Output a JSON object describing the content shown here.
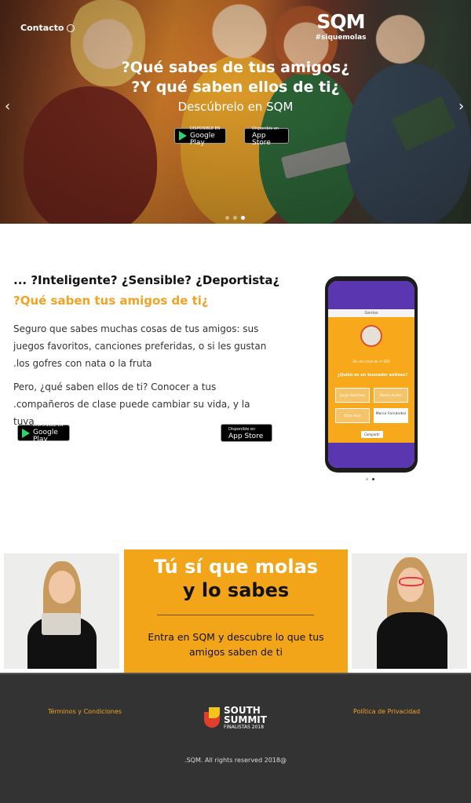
{
  "hero": {
    "contact_label": "Contacto",
    "logo_text": "SQM",
    "logo_tag": "#siquemolas",
    "title_line1": "?Qué sabes de tus amigos¿",
    "title_line2": "?Y qué saben ellos de ti¿",
    "subtitle": "Descúbrelo en SQM",
    "carousel_slides": 3,
    "active_slide": 3
  },
  "stores": {
    "google_small": "DISPONIBLE EN",
    "google_name": "Google Play",
    "apple_small": "Disponible en",
    "apple_name": "App Store"
  },
  "intro": {
    "question": "... ?Inteligente? ¿Sensible? ¿Deportista¿",
    "orange_question": "?Qué saben tus amigos de ti¿",
    "paragraph1": "Seguro que sabes muchas cosas de tus amigos: sus juegos favoritos, canciones preferidas, o si les gustan .los gofres con nata o la fruta",
    "paragraph2": "Pero, ¿qué saben ellos de ti? Conocer a tus .compañeros de clase puede cambiar su vida, y la tuya"
  },
  "phone_screen": {
    "header": "Genios",
    "small_text": "De una clase de 1º ESO",
    "question": "¿Quién es un buscador exitoso?",
    "options": [
      "Jorge Sanchez",
      "Marta Andes",
      "Elisa Ruiz",
      "Marco Fernández"
    ],
    "selected_option": "Marco Fernández",
    "share_label": "Compartir"
  },
  "banner": {
    "title1": "Tú sí que molas",
    "title2": "y lo sabes",
    "text": "Entra en SQM y descubre lo que tus amigos saben de ti"
  },
  "footer": {
    "terms": "Términos y Condiciones",
    "privacy": "Política de Privacidad",
    "sponsor_line1": "SOUTH",
    "sponsor_line2": "SUMMIT",
    "sponsor_line3": "FINALISTAS 2018",
    "copyright": ".SQM. All rights reserved 2018@"
  },
  "colors": {
    "accent_orange": "#f3a51a",
    "purple": "#5a36b0",
    "footer_bg": "#333333"
  }
}
